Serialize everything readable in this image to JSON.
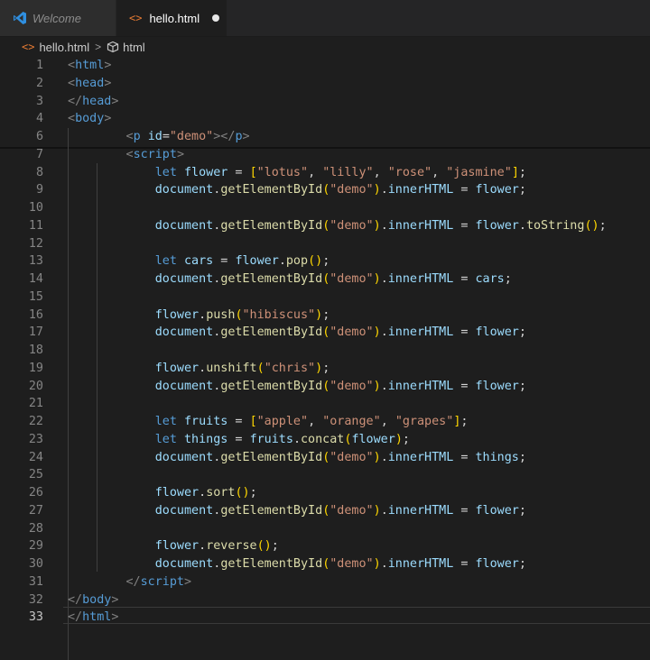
{
  "tabs": [
    {
      "label": "Welcome",
      "icon": "vscode-icon",
      "active": false
    },
    {
      "label": "hello.html",
      "icon": "html-file-icon",
      "active": true,
      "unsaved": true
    }
  ],
  "breadcrumb": {
    "file": "hello.html",
    "separator": ">",
    "element": "html"
  },
  "editor": {
    "active_line": 33,
    "lines": [
      {
        "n": "1",
        "tokens": [
          [
            "ang",
            "<"
          ],
          [
            "tag",
            "html"
          ],
          [
            "ang",
            ">"
          ]
        ]
      },
      {
        "n": "2",
        "tokens": [
          [
            "ang",
            "<"
          ],
          [
            "tag",
            "head"
          ],
          [
            "ang",
            ">"
          ]
        ]
      },
      {
        "n": "3",
        "tokens": [
          [
            "ang",
            "</"
          ],
          [
            "tag",
            "head"
          ],
          [
            "ang",
            ">"
          ]
        ]
      },
      {
        "n": "4",
        "tokens": [
          [
            "ang",
            "<"
          ],
          [
            "tag",
            "body"
          ],
          [
            "ang",
            ">"
          ]
        ]
      },
      {
        "n": "6",
        "tokens": [
          [
            "sp",
            "        "
          ],
          [
            "ang",
            "<"
          ],
          [
            "tag",
            "p"
          ],
          [
            "sp",
            " "
          ],
          [
            "attr",
            "id"
          ],
          [
            "punc",
            "="
          ],
          [
            "str",
            "\"demo\""
          ],
          [
            "ang",
            "></"
          ],
          [
            "tag",
            "p"
          ],
          [
            "ang",
            ">"
          ]
        ]
      },
      {
        "n": "7",
        "tokens": [
          [
            "sp",
            "        "
          ],
          [
            "ang",
            "<"
          ],
          [
            "tag",
            "script"
          ],
          [
            "ang",
            ">"
          ]
        ]
      },
      {
        "n": "8",
        "tokens": [
          [
            "sp",
            "            "
          ],
          [
            "kw",
            "let"
          ],
          [
            "sp",
            " "
          ],
          [
            "var",
            "flower"
          ],
          [
            "punc",
            " = "
          ],
          [
            "b1",
            "["
          ],
          [
            "str",
            "\"lotus\""
          ],
          [
            "punc",
            ", "
          ],
          [
            "str",
            "\"lilly\""
          ],
          [
            "punc",
            ", "
          ],
          [
            "str",
            "\"rose\""
          ],
          [
            "punc",
            ", "
          ],
          [
            "str",
            "\"jasmine\""
          ],
          [
            "b1",
            "]"
          ],
          [
            "punc",
            ";"
          ]
        ]
      },
      {
        "n": "9",
        "tokens": [
          [
            "sp",
            "            "
          ],
          [
            "var",
            "document"
          ],
          [
            "punc",
            "."
          ],
          [
            "fn",
            "getElementById"
          ],
          [
            "b1",
            "("
          ],
          [
            "str",
            "\"demo\""
          ],
          [
            "b1",
            ")"
          ],
          [
            "punc",
            "."
          ],
          [
            "var",
            "innerHTML"
          ],
          [
            "punc",
            " = "
          ],
          [
            "var",
            "flower"
          ],
          [
            "punc",
            ";"
          ]
        ]
      },
      {
        "n": "10",
        "tokens": []
      },
      {
        "n": "11",
        "tokens": [
          [
            "sp",
            "            "
          ],
          [
            "var",
            "document"
          ],
          [
            "punc",
            "."
          ],
          [
            "fn",
            "getElementById"
          ],
          [
            "b1",
            "("
          ],
          [
            "str",
            "\"demo\""
          ],
          [
            "b1",
            ")"
          ],
          [
            "punc",
            "."
          ],
          [
            "var",
            "innerHTML"
          ],
          [
            "punc",
            " = "
          ],
          [
            "var",
            "flower"
          ],
          [
            "punc",
            "."
          ],
          [
            "fn",
            "toString"
          ],
          [
            "b1",
            "()"
          ],
          [
            "punc",
            ";"
          ]
        ]
      },
      {
        "n": "12",
        "tokens": []
      },
      {
        "n": "13",
        "tokens": [
          [
            "sp",
            "            "
          ],
          [
            "kw",
            "let"
          ],
          [
            "sp",
            " "
          ],
          [
            "var",
            "cars"
          ],
          [
            "punc",
            " = "
          ],
          [
            "var",
            "flower"
          ],
          [
            "punc",
            "."
          ],
          [
            "fn",
            "pop"
          ],
          [
            "b1",
            "()"
          ],
          [
            "punc",
            ";"
          ]
        ]
      },
      {
        "n": "14",
        "tokens": [
          [
            "sp",
            "            "
          ],
          [
            "var",
            "document"
          ],
          [
            "punc",
            "."
          ],
          [
            "fn",
            "getElementById"
          ],
          [
            "b1",
            "("
          ],
          [
            "str",
            "\"demo\""
          ],
          [
            "b1",
            ")"
          ],
          [
            "punc",
            "."
          ],
          [
            "var",
            "innerHTML"
          ],
          [
            "punc",
            " = "
          ],
          [
            "var",
            "cars"
          ],
          [
            "punc",
            ";"
          ]
        ]
      },
      {
        "n": "15",
        "tokens": []
      },
      {
        "n": "16",
        "tokens": [
          [
            "sp",
            "            "
          ],
          [
            "var",
            "flower"
          ],
          [
            "punc",
            "."
          ],
          [
            "fn",
            "push"
          ],
          [
            "b1",
            "("
          ],
          [
            "str",
            "\"hibiscus\""
          ],
          [
            "b1",
            ")"
          ],
          [
            "punc",
            ";"
          ]
        ]
      },
      {
        "n": "17",
        "tokens": [
          [
            "sp",
            "            "
          ],
          [
            "var",
            "document"
          ],
          [
            "punc",
            "."
          ],
          [
            "fn",
            "getElementById"
          ],
          [
            "b1",
            "("
          ],
          [
            "str",
            "\"demo\""
          ],
          [
            "b1",
            ")"
          ],
          [
            "punc",
            "."
          ],
          [
            "var",
            "innerHTML"
          ],
          [
            "punc",
            " = "
          ],
          [
            "var",
            "flower"
          ],
          [
            "punc",
            ";"
          ]
        ]
      },
      {
        "n": "18",
        "tokens": []
      },
      {
        "n": "19",
        "tokens": [
          [
            "sp",
            "            "
          ],
          [
            "var",
            "flower"
          ],
          [
            "punc",
            "."
          ],
          [
            "fn",
            "unshift"
          ],
          [
            "b1",
            "("
          ],
          [
            "str",
            "\"chris\""
          ],
          [
            "b1",
            ")"
          ],
          [
            "punc",
            ";"
          ]
        ]
      },
      {
        "n": "20",
        "tokens": [
          [
            "sp",
            "            "
          ],
          [
            "var",
            "document"
          ],
          [
            "punc",
            "."
          ],
          [
            "fn",
            "getElementById"
          ],
          [
            "b1",
            "("
          ],
          [
            "str",
            "\"demo\""
          ],
          [
            "b1",
            ")"
          ],
          [
            "punc",
            "."
          ],
          [
            "var",
            "innerHTML"
          ],
          [
            "punc",
            " = "
          ],
          [
            "var",
            "flower"
          ],
          [
            "punc",
            ";"
          ]
        ]
      },
      {
        "n": "21",
        "tokens": []
      },
      {
        "n": "22",
        "tokens": [
          [
            "sp",
            "            "
          ],
          [
            "kw",
            "let"
          ],
          [
            "sp",
            " "
          ],
          [
            "var",
            "fruits"
          ],
          [
            "punc",
            " = "
          ],
          [
            "b1",
            "["
          ],
          [
            "str",
            "\"apple\""
          ],
          [
            "punc",
            ", "
          ],
          [
            "str",
            "\"orange\""
          ],
          [
            "punc",
            ", "
          ],
          [
            "str",
            "\"grapes\""
          ],
          [
            "b1",
            "]"
          ],
          [
            "punc",
            ";"
          ]
        ]
      },
      {
        "n": "23",
        "tokens": [
          [
            "sp",
            "            "
          ],
          [
            "kw",
            "let"
          ],
          [
            "sp",
            " "
          ],
          [
            "var",
            "things"
          ],
          [
            "punc",
            " = "
          ],
          [
            "var",
            "fruits"
          ],
          [
            "punc",
            "."
          ],
          [
            "fn",
            "concat"
          ],
          [
            "b1",
            "("
          ],
          [
            "var",
            "flower"
          ],
          [
            "b1",
            ")"
          ],
          [
            "punc",
            ";"
          ]
        ]
      },
      {
        "n": "24",
        "tokens": [
          [
            "sp",
            "            "
          ],
          [
            "var",
            "document"
          ],
          [
            "punc",
            "."
          ],
          [
            "fn",
            "getElementById"
          ],
          [
            "b1",
            "("
          ],
          [
            "str",
            "\"demo\""
          ],
          [
            "b1",
            ")"
          ],
          [
            "punc",
            "."
          ],
          [
            "var",
            "innerHTML"
          ],
          [
            "punc",
            " = "
          ],
          [
            "var",
            "things"
          ],
          [
            "punc",
            ";"
          ]
        ]
      },
      {
        "n": "25",
        "tokens": []
      },
      {
        "n": "26",
        "tokens": [
          [
            "sp",
            "            "
          ],
          [
            "var",
            "flower"
          ],
          [
            "punc",
            "."
          ],
          [
            "fn",
            "sort"
          ],
          [
            "b1",
            "()"
          ],
          [
            "punc",
            ";"
          ]
        ]
      },
      {
        "n": "27",
        "tokens": [
          [
            "sp",
            "            "
          ],
          [
            "var",
            "document"
          ],
          [
            "punc",
            "."
          ],
          [
            "fn",
            "getElementById"
          ],
          [
            "b1",
            "("
          ],
          [
            "str",
            "\"demo\""
          ],
          [
            "b1",
            ")"
          ],
          [
            "punc",
            "."
          ],
          [
            "var",
            "innerHTML"
          ],
          [
            "punc",
            " = "
          ],
          [
            "var",
            "flower"
          ],
          [
            "punc",
            ";"
          ]
        ]
      },
      {
        "n": "28",
        "tokens": []
      },
      {
        "n": "29",
        "tokens": [
          [
            "sp",
            "            "
          ],
          [
            "var",
            "flower"
          ],
          [
            "punc",
            "."
          ],
          [
            "fn",
            "reverse"
          ],
          [
            "b1",
            "()"
          ],
          [
            "punc",
            ";"
          ]
        ]
      },
      {
        "n": "30",
        "tokens": [
          [
            "sp",
            "            "
          ],
          [
            "var",
            "document"
          ],
          [
            "punc",
            "."
          ],
          [
            "fn",
            "getElementById"
          ],
          [
            "b1",
            "("
          ],
          [
            "str",
            "\"demo\""
          ],
          [
            "b1",
            ")"
          ],
          [
            "punc",
            "."
          ],
          [
            "var",
            "innerHTML"
          ],
          [
            "punc",
            " = "
          ],
          [
            "var",
            "flower"
          ],
          [
            "punc",
            ";"
          ]
        ]
      },
      {
        "n": "31",
        "tokens": [
          [
            "sp",
            "        "
          ],
          [
            "ang",
            "</"
          ],
          [
            "tag",
            "script"
          ],
          [
            "ang",
            ">"
          ]
        ]
      },
      {
        "n": "32",
        "tokens": [
          [
            "ang",
            "</"
          ],
          [
            "tag",
            "body"
          ],
          [
            "ang",
            ">"
          ]
        ]
      },
      {
        "n": "33",
        "tokens": [
          [
            "ang",
            "</"
          ],
          [
            "tag",
            "html"
          ],
          [
            "ang",
            ">"
          ]
        ]
      }
    ]
  },
  "colors": {
    "background": "#1e1e1e",
    "tab_bar": "#252526",
    "tag": "#569cd6",
    "string": "#ce9178",
    "variable": "#9cdcfe",
    "function": "#dcdcaa",
    "keyword": "#569cd6",
    "bracket": "#ffd700",
    "line_number": "#858585"
  }
}
